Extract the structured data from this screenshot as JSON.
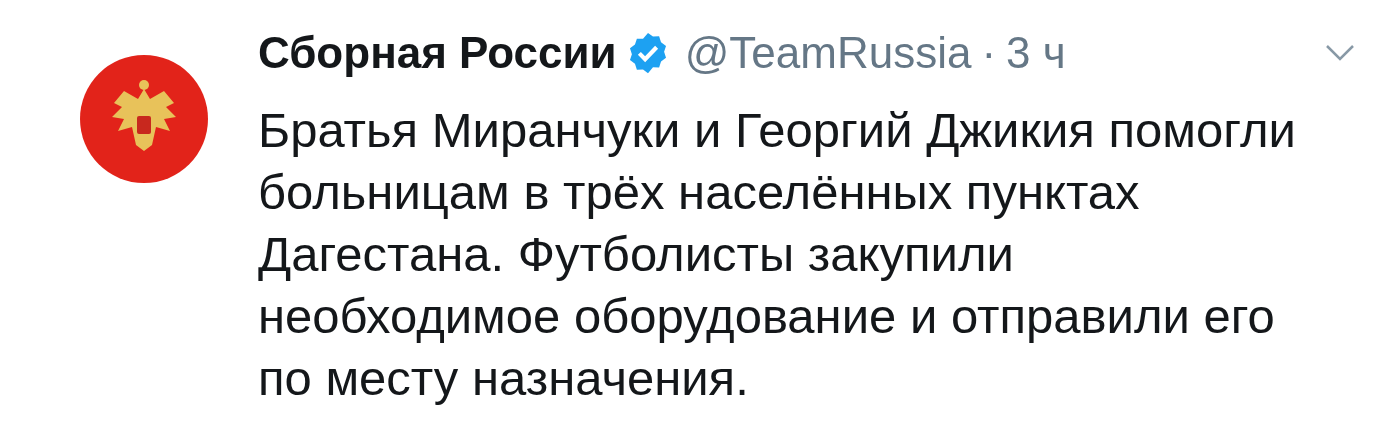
{
  "tweet": {
    "author_name": "Сборная России",
    "verified": true,
    "handle": "@TeamRussia",
    "separator": "·",
    "time": "3 ч",
    "text_lines": [
      "Братья Миранчуки и Георгий Джикия помогли",
      "больницам в трёх населённых пунктах",
      "Дагестана. Футболисты закупили",
      "необходимое оборудование и отправили его",
      "по месту назначения."
    ]
  }
}
